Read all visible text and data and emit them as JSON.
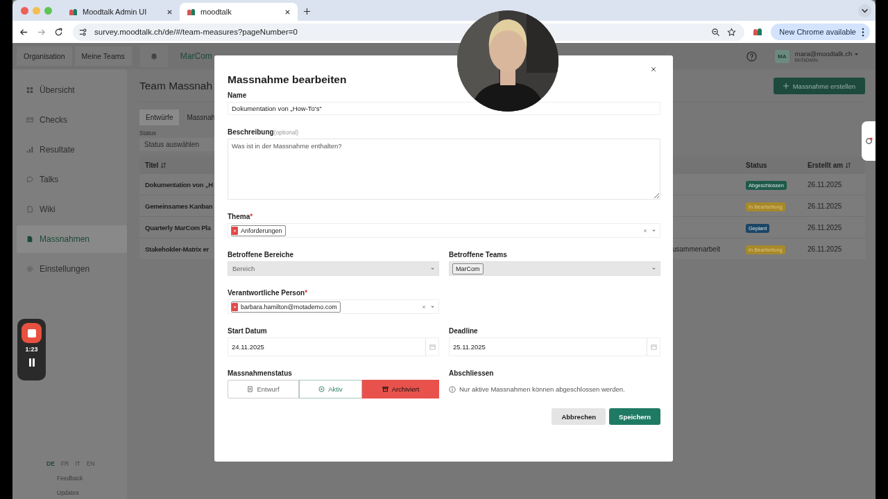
{
  "browser": {
    "tabs": [
      {
        "title": "Moodtalk Admin UI",
        "selected": false
      },
      {
        "title": "moodtalk",
        "selected": true
      }
    ],
    "url": "survey.moodtalk.ch/de/#/team-measures?pageNumber=0",
    "update_button": "New Chrome available"
  },
  "topbar": {
    "nav": [
      "Organisation",
      "Meine Teams"
    ],
    "team": "MarCom",
    "user": {
      "initials": "MA",
      "email": "mara@moodtalk.ch",
      "org": "MoTaDeMo"
    }
  },
  "sidebar": {
    "items": [
      {
        "label": "Übersicht",
        "selected": false
      },
      {
        "label": "Checks",
        "selected": false
      },
      {
        "label": "Resultate",
        "selected": false
      },
      {
        "label": "Talks",
        "selected": false
      },
      {
        "label": "Wiki",
        "selected": false
      },
      {
        "label": "Massnahmen",
        "selected": true
      },
      {
        "label": "Einstellungen",
        "selected": false
      }
    ],
    "languages": [
      {
        "code": "DE",
        "selected": true
      },
      {
        "code": "FR",
        "selected": false
      },
      {
        "code": "IT",
        "selected": false
      },
      {
        "code": "EN",
        "selected": false
      }
    ],
    "links": [
      "Feedback",
      "Updates"
    ]
  },
  "page": {
    "title": "Team Massnah",
    "create_button": "Massnahme erstellen",
    "tabs": [
      {
        "label": "Entwürfe",
        "selected": true
      },
      {
        "label": "Massnah",
        "selected": false
      }
    ],
    "filter": {
      "label": "Status",
      "placeholder": "Status auswählen"
    },
    "table": {
      "columns": [
        {
          "label": "Titel",
          "sortable": true
        },
        {
          "label": "Status",
          "sortable": false
        },
        {
          "label": "Erstellt am",
          "sortable": true
        }
      ],
      "rows": [
        {
          "title": "Dokumentation von „H",
          "status": "Abgeschlossen",
          "color": "#1d5a4a",
          "created": "26.11.2025"
        },
        {
          "title": "Gemeinsames Kanban",
          "status": "In Bearbeitung",
          "color": "#a8892a",
          "created": "26.11.2025"
        },
        {
          "title": "Quarterly MarCom Pla",
          "status": "Geplant",
          "color": "#1c4566",
          "created": "26.11.2025"
        },
        {
          "title": "Stakeholder-Matrix er",
          "column_3": "usammenarbeit",
          "status": "In Bearbeitung",
          "color": "#a8892a",
          "created": "26.11.2025"
        }
      ]
    }
  },
  "modal": {
    "title": "Massnahme bearbeiten",
    "rows": [
      {
        "fields": [
          {
            "kind": "text",
            "label": "Name",
            "value": "Dokumentation von „How-To's“"
          }
        ]
      },
      {
        "fields": [
          {
            "kind": "textarea",
            "label": "Beschreibung",
            "hint": "(optional)",
            "placeholder": "Was ist in der Massnahme enthalten?"
          }
        ]
      },
      {
        "fields": [
          {
            "kind": "multiselect",
            "label": "Thema",
            "required_mark": "*",
            "disabled": false,
            "clearable": true,
            "tags": [
              {
                "label": "Anforderungen",
                "removable": true
              }
            ]
          }
        ]
      },
      {
        "fields": [
          {
            "kind": "multiselect",
            "label": "Betroffene Bereiche",
            "disabled": true,
            "clearable": false,
            "placeholder": "Bereich"
          },
          {
            "kind": "multiselect",
            "label": "Betroffene Teams",
            "disabled": true,
            "clearable": false,
            "tags": [
              {
                "label": "MarCom",
                "removable": false
              }
            ]
          }
        ]
      },
      {
        "fields": [
          {
            "kind": "multiselect",
            "label": "Verantwortliche Person",
            "required_mark": "*",
            "disabled": false,
            "clearable": true,
            "tags": [
              {
                "label": "barbara.hamilton@motademo.com",
                "removable": true
              }
            ]
          }
        ]
      },
      {
        "fields": [
          {
            "kind": "date",
            "label": "Start Datum",
            "value": "24.11.2025"
          },
          {
            "kind": "date",
            "label": "Deadline",
            "value": "25.11.2025"
          }
        ]
      },
      {
        "fields": [
          {
            "kind": "segmented",
            "label": "Massnahmenstatus",
            "options": [
              {
                "label": "Entwurf",
                "kind": "draft",
                "selected": false
              },
              {
                "label": "Aktiv",
                "kind": "active",
                "selected": false
              },
              {
                "label": "Archiviert",
                "kind": "archive",
                "selected": true
              }
            ]
          },
          {
            "kind": "info",
            "label": "Abschliessen",
            "text": "Nur aktive Massnahmen können abgeschlossen werden."
          }
        ]
      }
    ],
    "buttons": [
      {
        "label": "Abbrechen",
        "kind": "secondary"
      },
      {
        "label": "Speichern",
        "kind": "primary"
      }
    ]
  },
  "recorder": {
    "time": "1:23"
  }
}
